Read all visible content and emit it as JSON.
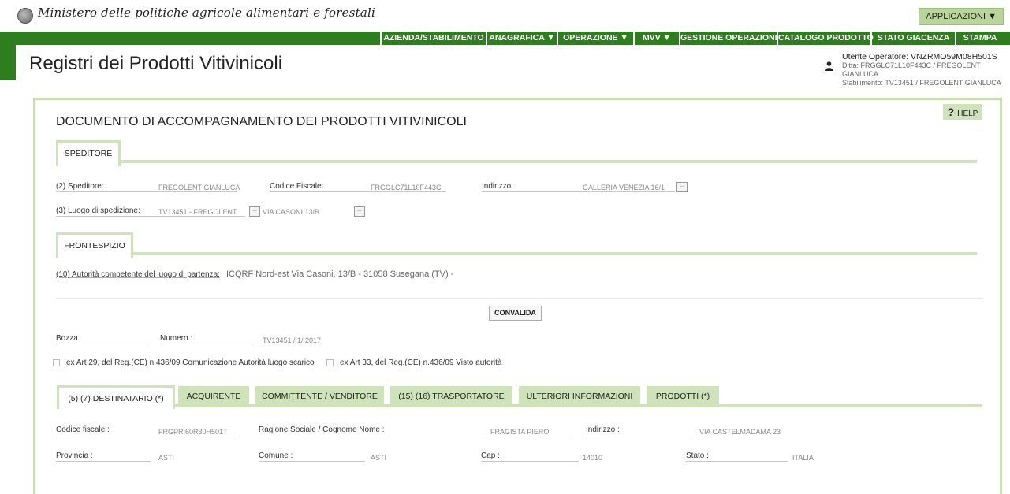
{
  "header": {
    "ministry": "Ministero delle politiche agricole alimentari e forestali",
    "applicazioni": "APPLICAZIONI ▼"
  },
  "nav": {
    "items": [
      {
        "label": "AZIENDA/STABILIMENTO"
      },
      {
        "label": "ANAGRAFICA ▼"
      },
      {
        "label": "OPERAZIONE ▼"
      },
      {
        "label": "MVV ▼"
      },
      {
        "label": "GESTIONE OPERAZIONI"
      },
      {
        "label": "CATALOGO PRODOTTO"
      },
      {
        "label": "STATO GIACENZA"
      },
      {
        "label": "STAMPA"
      }
    ]
  },
  "page": {
    "title": "Registri dei Prodotti Vitivinicoli"
  },
  "user": {
    "operatore": "Utente Operatore: VNZRMO59M08H501S",
    "ditta": "Ditta: FRGGLC71L10F443C / FREGOLENT GIANLUCA",
    "stabilimento": "Stabilimento: TV13451 / FREGOLENT GIANLUCA"
  },
  "form": {
    "help": "HELP",
    "doc_title": "DOCUMENTO DI ACCOMPAGNAMENTO DEI PRODOTTI VITIVINICOLI",
    "speditore_tab": "SPEDITORE",
    "speditore_label": "(2) Speditore:",
    "speditore_value": "FREGOLENT GIANLUCA",
    "cf_label": "Codice Fiscale:",
    "cf_value": "FRGGLC71L10F443C",
    "indirizzo_label": "Indirizzo:",
    "indirizzo_value": "GALLERIA VENEZIA 16/1",
    "luogo_label": "(3) Luogo di spedizione:",
    "luogo_value": "TV13451 - FREGOLENT",
    "luogo_addr": "VIA CASONI 13/B",
    "frontespizio_tab": "FRONTESPIZIO",
    "autorita_label": "(10) Autorità competente del luogo di partenza:",
    "autorita_value": "ICQRF Nord-est Via Casoni, 13/B - 31058 Susegana (TV)  -",
    "convalida": "CONVALIDA",
    "bozza": "Bozza",
    "numero_label": "Numero :",
    "numero_value": "TV13451 / 1/ 2017",
    "check1": "ex Art 29, del Reg.(CE) n.436/09 Comunicazione Autorità luogo scarico",
    "check2": "ex Art 33, del Reg.(CE) n.436/09 Visto autorità"
  },
  "tabs": [
    {
      "label": "(5) (7) DESTINATARIO (*)"
    },
    {
      "label": "ACQUIRENTE"
    },
    {
      "label": "COMMITTENTE / VENDITORE"
    },
    {
      "label": "(15) (16) TRASPORTATORE"
    },
    {
      "label": "ULTERIORI INFORMAZIONI"
    },
    {
      "label": "PRODOTTI (*)"
    }
  ],
  "destinatario": {
    "cf_label": "Codice fiscale :",
    "cf_value": "FRGPRI60R30H501T",
    "ragione_label": "Ragione Sociale / Cognome Nome :",
    "ragione_value": "FRAGISTA PIERO",
    "indirizzo_label": "Indirizzo :",
    "indirizzo_value": "VIA CASTELMADAMA 23",
    "provincia_label": "Provincia :",
    "provincia_value": "ASTI",
    "comune_label": "Comune :",
    "comune_value": "ASTI",
    "cap_label": "Cap :",
    "cap_value": "14010",
    "stato_label": "Stato :",
    "stato_value": "ITALIA"
  }
}
